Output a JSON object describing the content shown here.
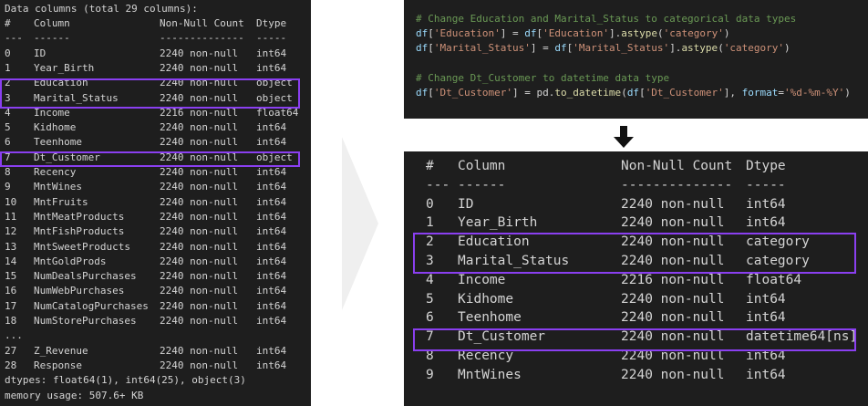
{
  "left": {
    "title": "Data columns (total 29 columns):",
    "header": [
      "#",
      "Column",
      "Non-Null Count",
      "Dtype"
    ],
    "dashes": [
      "---",
      "------",
      "--------------",
      "-----"
    ],
    "rows": [
      [
        "0",
        "ID",
        "2240 non-null",
        "int64"
      ],
      [
        "1",
        "Year_Birth",
        "2240 non-null",
        "int64"
      ],
      [
        "2",
        "Education",
        "2240 non-null",
        "object"
      ],
      [
        "3",
        "Marital_Status",
        "2240 non-null",
        "object"
      ],
      [
        "4",
        "Income",
        "2216 non-null",
        "float64"
      ],
      [
        "5",
        "Kidhome",
        "2240 non-null",
        "int64"
      ],
      [
        "6",
        "Teenhome",
        "2240 non-null",
        "int64"
      ],
      [
        "7",
        "Dt_Customer",
        "2240 non-null",
        "object"
      ],
      [
        "8",
        "Recency",
        "2240 non-null",
        "int64"
      ],
      [
        "9",
        "MntWines",
        "2240 non-null",
        "int64"
      ],
      [
        "10",
        "MntFruits",
        "2240 non-null",
        "int64"
      ],
      [
        "11",
        "MntMeatProducts",
        "2240 non-null",
        "int64"
      ],
      [
        "12",
        "MntFishProducts",
        "2240 non-null",
        "int64"
      ],
      [
        "13",
        "MntSweetProducts",
        "2240 non-null",
        "int64"
      ],
      [
        "14",
        "MntGoldProds",
        "2240 non-null",
        "int64"
      ],
      [
        "15",
        "NumDealsPurchases",
        "2240 non-null",
        "int64"
      ],
      [
        "16",
        "NumWebPurchases",
        "2240 non-null",
        "int64"
      ],
      [
        "17",
        "NumCatalogPurchases",
        "2240 non-null",
        "int64"
      ],
      [
        "18",
        "NumStorePurchases",
        "2240 non-null",
        "int64"
      ]
    ],
    "ellipsis": "...",
    "tail_rows": [
      [
        "27",
        "Z_Revenue",
        "2240 non-null",
        "int64"
      ],
      [
        "28",
        "Response",
        "2240 non-null",
        "int64"
      ]
    ],
    "dtypes_line": "dtypes: float64(1), int64(25), object(3)",
    "memory_line": "memory usage: 507.6+ KB"
  },
  "code": {
    "comment1": "# Change Education and Marital_Status to categorical data types",
    "line1": [
      "df",
      "[",
      "'Education'",
      "] = ",
      "df",
      "[",
      "'Education'",
      "].",
      "astype",
      "(",
      "'category'",
      ")"
    ],
    "line2": [
      "df",
      "[",
      "'Marital_Status'",
      "] = ",
      "df",
      "[",
      "'Marital_Status'",
      "].",
      "astype",
      "(",
      "'category'",
      ")"
    ],
    "comment2": "# Change Dt_Customer to datetime data type",
    "line3": [
      "df",
      "[",
      "'Dt_Customer'",
      "] = pd.",
      "to_datetime",
      "(",
      "df",
      "[",
      "'Dt_Customer'",
      "], ",
      "format",
      "=",
      "'%d-%m-%Y'",
      ")"
    ]
  },
  "right": {
    "header": [
      "#",
      "Column",
      "Non-Null Count",
      "Dtype"
    ],
    "dashes": [
      "---",
      "------",
      "--------------",
      "-----"
    ],
    "rows": [
      [
        "0",
        "ID",
        "2240 non-null",
        "int64"
      ],
      [
        "1",
        "Year_Birth",
        "2240 non-null",
        "int64"
      ],
      [
        "2",
        "Education",
        "2240 non-null",
        "category"
      ],
      [
        "3",
        "Marital_Status",
        "2240 non-null",
        "category"
      ],
      [
        "4",
        "Income",
        "2216 non-null",
        "float64"
      ],
      [
        "5",
        "Kidhome",
        "2240 non-null",
        "int64"
      ],
      [
        "6",
        "Teenhome",
        "2240 non-null",
        "int64"
      ],
      [
        "7",
        "Dt_Customer",
        "2240 non-null",
        "datetime64[ns]"
      ],
      [
        "8",
        "Recency",
        "2240 non-null",
        "int64"
      ],
      [
        "9",
        "MntWines",
        "2240 non-null",
        "int64"
      ]
    ]
  },
  "colors": {
    "highlight": "#8a3ff0",
    "panel_bg": "#1e1e1e",
    "comment": "#6a9955",
    "string": "#ce9178",
    "variable": "#9cdcfe"
  }
}
